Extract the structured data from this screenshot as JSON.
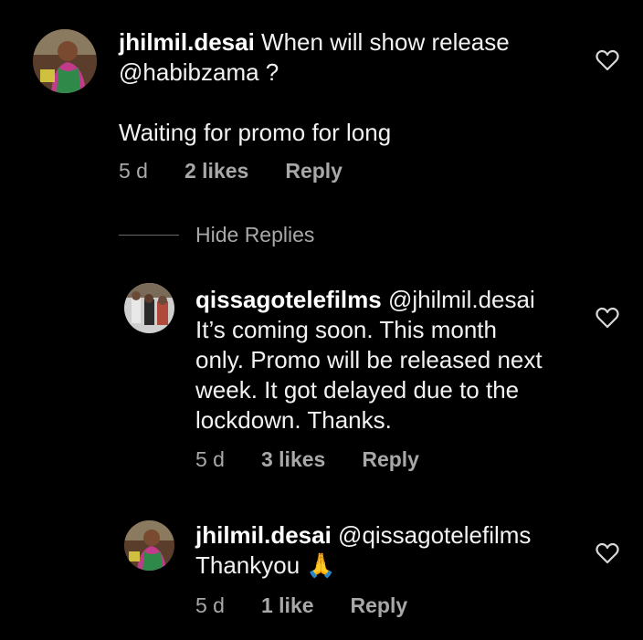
{
  "comments": [
    {
      "username": "jhilmil.desai",
      "text_line1": " When will show release",
      "text_line2": "@habibzama ?",
      "text_line3": "Waiting for promo for long",
      "time": "5 d",
      "likes": "2 likes",
      "reply_label": "Reply"
    }
  ],
  "replies_toggle": {
    "label": "Hide Replies"
  },
  "replies": [
    {
      "username": "qissagotelefilms",
      "mention": " @jhilmil.desai",
      "lines": [
        "It’s coming soon. This month",
        "only. Promo will be released next",
        "week. It got delayed due to the",
        "lockdown. Thanks."
      ],
      "time": "5 d",
      "likes": "3 likes",
      "reply_label": "Reply"
    },
    {
      "username": "jhilmil.desai",
      "mention": " @qissagotelefilms",
      "text": "Thankyou 🙏",
      "time": "5 d",
      "likes": "1 like",
      "reply_label": "Reply"
    }
  ],
  "icons": {
    "heart": "heart-outline-icon",
    "emoji": "folded-hands"
  },
  "colors": {
    "background": "#000000",
    "text": "#f2f2f2",
    "meta": "#a8a8a8"
  }
}
